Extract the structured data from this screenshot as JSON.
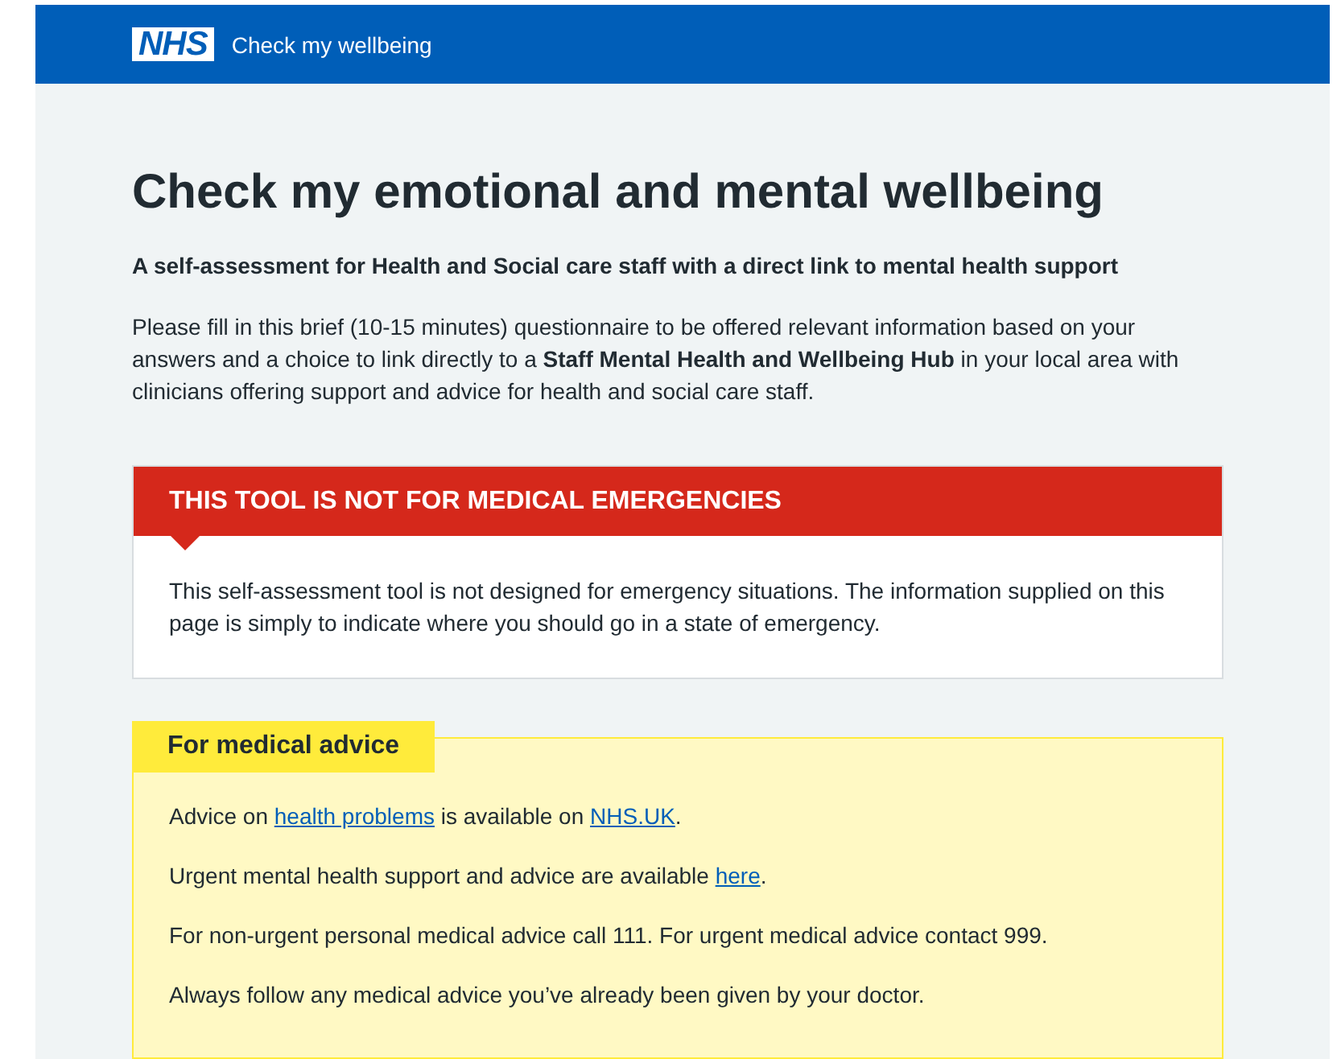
{
  "header": {
    "logo": "NHS",
    "service_name": "Check my wellbeing"
  },
  "title": "Check my emotional and mental wellbeing",
  "subtitle": "A self-assessment for Health and Social care staff with a direct link to mental health support",
  "intro": "Please fill in this brief (10-15 minutes) questionnaire to be offered relevant information based on your answers and a choice to link directly to a **Staff Mental Health and Wellbeing Hub** in your local area with clinicians offering support and advice for health and social care staff.",
  "warning": {
    "heading": "THIS TOOL IS NOT FOR MEDICAL EMERGENCIES",
    "body": "This self-assessment tool is not designed for emergency situations. The information supplied on this page is simply to indicate where you should go in a state of emergency."
  },
  "advice": {
    "heading": "For medical advice",
    "paragraphs": [
      [
        {
          "kind": "text",
          "text": "Advice on "
        },
        {
          "kind": "link",
          "text": "health problems"
        },
        {
          "kind": "text",
          "text": " is available on "
        },
        {
          "kind": "link",
          "text": "NHS.UK"
        },
        {
          "kind": "text",
          "text": "."
        }
      ],
      [
        {
          "kind": "text",
          "text": "Urgent mental health support and advice are available "
        },
        {
          "kind": "link",
          "text": "here"
        },
        {
          "kind": "text",
          "text": "."
        }
      ],
      [
        {
          "kind": "text",
          "text": "For non-urgent personal medical advice call 111. For urgent medical advice contact 999."
        }
      ],
      [
        {
          "kind": "text",
          "text": "Always follow any medical advice you’ve already been given by your doctor."
        }
      ]
    ]
  }
}
